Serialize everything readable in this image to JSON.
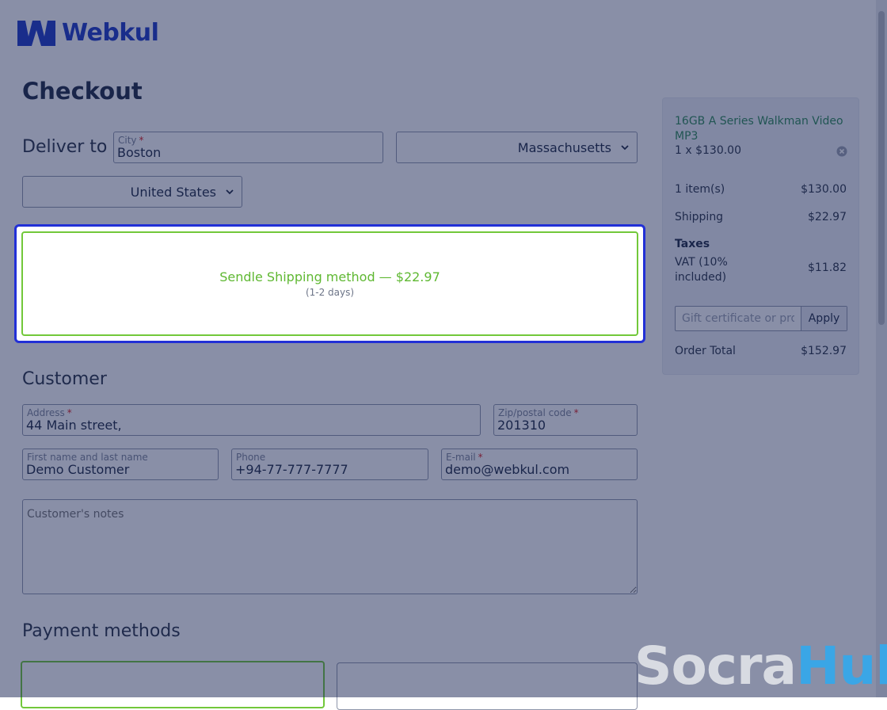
{
  "brand": {
    "name": "Webkul",
    "color": "#1f3bc6"
  },
  "page": {
    "title": "Checkout"
  },
  "deliver": {
    "label": "Deliver to",
    "city": {
      "label": "City",
      "value": "Boston"
    },
    "state": {
      "value": "Massachusetts"
    },
    "country": {
      "value": "United States"
    }
  },
  "shipping": {
    "name": "Sendle Shipping method — $22.97",
    "days": "(1-2 days)",
    "accent_color": "#72c83a",
    "highlight_color": "#2230d6"
  },
  "customer": {
    "heading": "Customer",
    "address": {
      "label": "Address",
      "value": "44 Main street,"
    },
    "zip": {
      "label": "Zip/postal code",
      "value": "201310"
    },
    "name": {
      "label": "First name and last name",
      "value": "Demo Customer"
    },
    "phone": {
      "label": "Phone",
      "value": "+94-77-777-7777"
    },
    "email": {
      "label": "E-mail",
      "value": "demo@webkul.com"
    },
    "notes_placeholder": "Customer's notes"
  },
  "payment": {
    "heading": "Payment methods"
  },
  "summary": {
    "product_name": "16GB A Series Walkman Video MP3",
    "product_qty": "1 x $130.00",
    "items_label": "1 item(s)",
    "items_value": "$130.00",
    "shipping_label": "Shipping",
    "shipping_value": "$22.97",
    "taxes_label": "Taxes",
    "vat_label": "VAT (10% included)",
    "vat_value": "$11.82",
    "promo_placeholder": "Gift certificate or promo code",
    "apply_label": "Apply",
    "total_label": "Order Total",
    "total_value": "$152.97"
  },
  "watermark": {
    "part1": "Socra",
    "part2": "Hub"
  }
}
